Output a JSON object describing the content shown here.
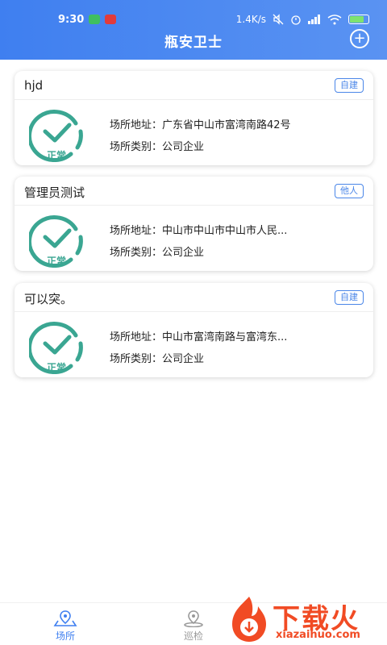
{
  "status_bar": {
    "time": "9:30",
    "network_speed": "1.4K/s",
    "icons": [
      "wechat-icon",
      "netease-icon",
      "mute-icon",
      "alarm-icon",
      "signal-icon",
      "wifi-icon",
      "battery-icon"
    ]
  },
  "header": {
    "title": "瓶安卫士",
    "add_icon": "plus-circle-icon"
  },
  "places": [
    {
      "title": "hjd",
      "tag": "自建",
      "status": "正常",
      "address_line": "场所地址：广东省中山市富湾南路42号",
      "type_line": "场所类别：公司企业"
    },
    {
      "title": "管理员测试",
      "tag": "他人",
      "status": "正常",
      "address_line": "场所地址：中山市中山市中山市人民...",
      "type_line": "场所类别：公司企业"
    },
    {
      "title": "可以突。",
      "tag": "自建",
      "status": "正常",
      "address_line": "场所地址：中山市富湾南路与富湾东...",
      "type_line": "场所类别：公司企业"
    }
  ],
  "bottom_nav": {
    "places_label": "场所",
    "patrol_label": "巡检"
  },
  "watermark": {
    "brand": "下载火",
    "domain": "xiazaihuo.com"
  },
  "colors": {
    "header": "#3f7ff0",
    "tag": "#4a86e8",
    "status_ok": "#3aa692",
    "watermark": "#f14b24"
  }
}
